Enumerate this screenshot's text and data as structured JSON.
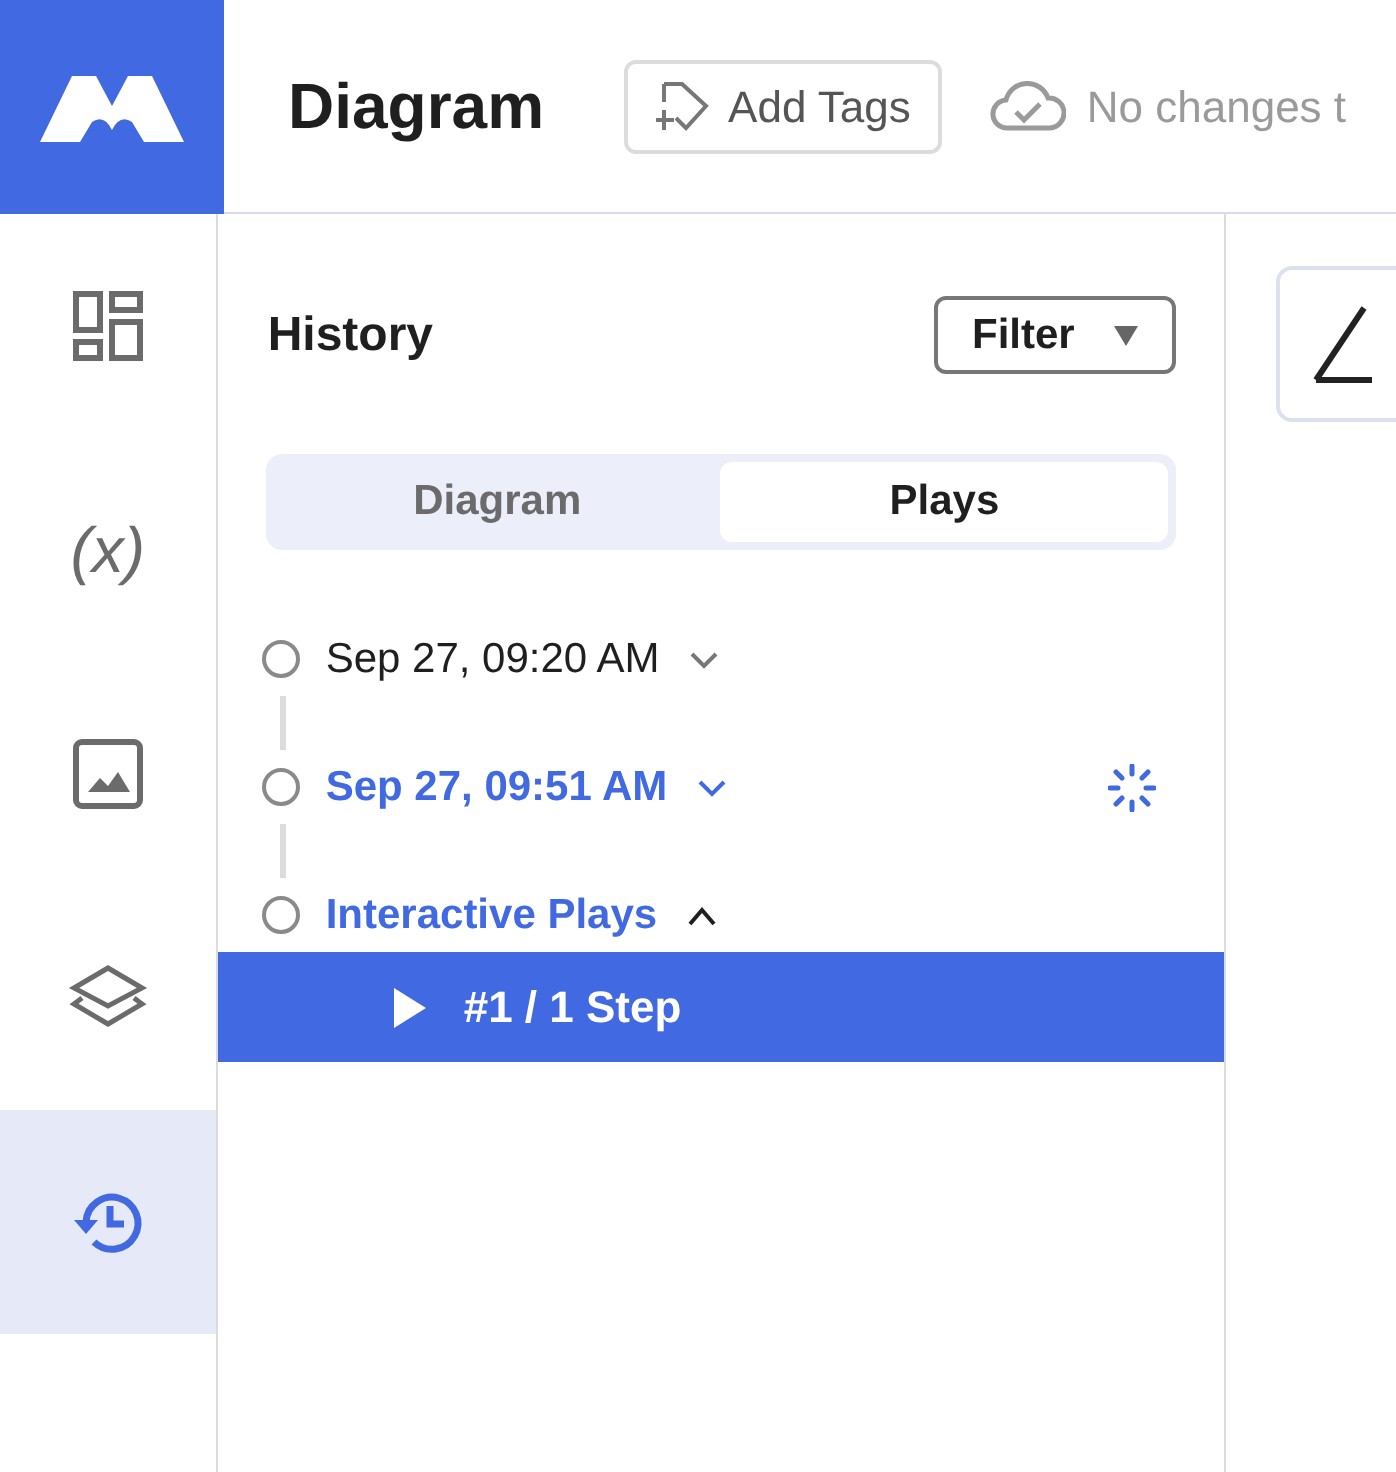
{
  "header": {
    "title": "Diagram",
    "add_tags": "Add Tags",
    "status": "No changes t"
  },
  "sidebar": {
    "items": [
      {
        "kind": "widgets",
        "selected": false
      },
      {
        "kind": "variable",
        "text": "(x)",
        "selected": false
      },
      {
        "kind": "image",
        "selected": false
      },
      {
        "kind": "layers",
        "selected": false
      },
      {
        "kind": "history",
        "selected": true
      }
    ]
  },
  "history": {
    "title": "History",
    "filter": "Filter",
    "tabs": [
      {
        "label": "Diagram",
        "selected": false
      },
      {
        "label": "Plays",
        "selected": true
      }
    ],
    "entries": [
      {
        "label": "Sep 27, 09:20 AM",
        "highlighted": false,
        "expanded": false,
        "loading": false
      },
      {
        "label": "Sep 27, 09:51 AM",
        "highlighted": true,
        "expanded": false,
        "loading": true
      },
      {
        "label": "Interactive Plays",
        "highlighted": true,
        "expanded": true,
        "loading": false,
        "children": [
          {
            "label": "#1 / 1 Step",
            "selected": true
          }
        ]
      }
    ]
  }
}
